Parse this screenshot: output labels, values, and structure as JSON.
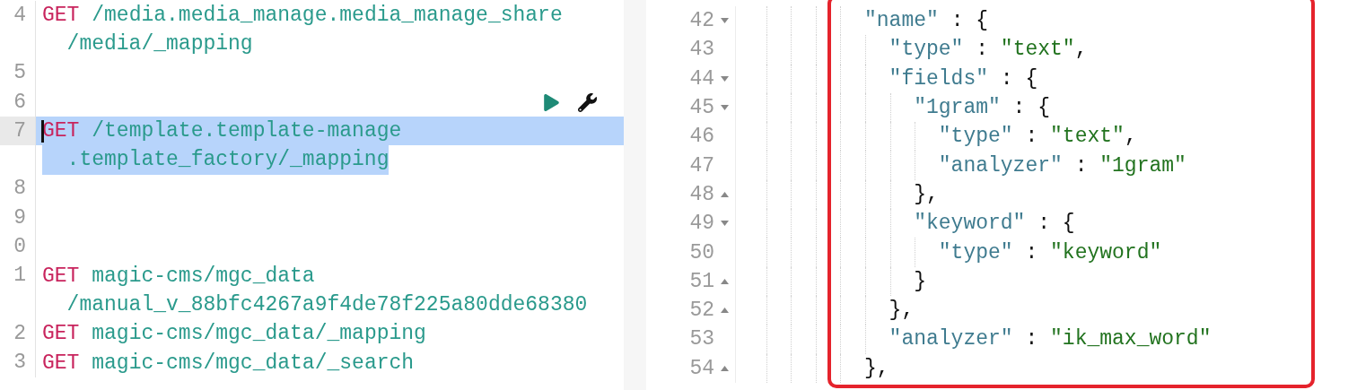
{
  "request_editor": {
    "rows": [
      {
        "number": "4",
        "method": "GET",
        "path": "/media.media_manage.media_manage_share",
        "selected": false,
        "cursor": false,
        "actions": false
      },
      {
        "continuation": "/media/_mapping",
        "selected": false
      },
      {
        "number": "5",
        "selected": false,
        "cursor": false,
        "actions": false
      },
      {
        "number": "6",
        "selected": false,
        "cursor": false,
        "actions": true
      },
      {
        "number": "7",
        "method": "GET",
        "path": "/template.template-manage",
        "selected": true,
        "cursor": true,
        "actions": false
      },
      {
        "continuation": ".template_factory/_mapping",
        "selected": true
      },
      {
        "number": "8",
        "selected": false,
        "cursor": false,
        "actions": false
      },
      {
        "number": "9",
        "selected": false,
        "cursor": false,
        "actions": false
      },
      {
        "number": "0",
        "selected": false,
        "cursor": false,
        "actions": false
      },
      {
        "number": "1",
        "method": "GET",
        "path": "magic-cms/mgc_data",
        "selected": false,
        "cursor": false,
        "actions": false
      },
      {
        "continuation": "/manual_v_88bfc4267a9f4de78f225a80dde68380",
        "selected": false
      },
      {
        "number": "2",
        "method": "GET",
        "path": "magic-cms/mgc_data/_mapping",
        "selected": false,
        "cursor": false,
        "actions": false
      },
      {
        "number": "3",
        "method": "GET",
        "path": "magic-cms/mgc_data/_search",
        "selected": false,
        "cursor": false,
        "actions": false
      }
    ]
  },
  "response_viewer": {
    "framed": true,
    "lines": [
      {
        "number": "42",
        "expanded": true,
        "tokens": [
          {
            "kind": "key",
            "text": "\"name\""
          },
          {
            "kind": "punct",
            "text": " : {"
          }
        ],
        "children": [
          {
            "number": "43",
            "tokens": [
              {
                "kind": "key",
                "text": "\"type\""
              },
              {
                "kind": "punct",
                "text": " : "
              },
              {
                "kind": "string",
                "text": "\"text\""
              },
              {
                "kind": "punct",
                "text": ","
              }
            ]
          },
          {
            "number": "44",
            "expanded": true,
            "tokens": [
              {
                "kind": "key",
                "text": "\"fields\""
              },
              {
                "kind": "punct",
                "text": " : {"
              }
            ],
            "children": [
              {
                "number": "45",
                "expanded": true,
                "tokens": [
                  {
                    "kind": "key",
                    "text": "\"1gram\""
                  },
                  {
                    "kind": "punct",
                    "text": " : {"
                  }
                ],
                "children": [
                  {
                    "number": "46",
                    "tokens": [
                      {
                        "kind": "key",
                        "text": "\"type\""
                      },
                      {
                        "kind": "punct",
                        "text": " : "
                      },
                      {
                        "kind": "string",
                        "text": "\"text\""
                      },
                      {
                        "kind": "punct",
                        "text": ","
                      }
                    ]
                  },
                  {
                    "number": "47",
                    "tokens": [
                      {
                        "kind": "key",
                        "text": "\"analyzer\""
                      },
                      {
                        "kind": "punct",
                        "text": " : "
                      },
                      {
                        "kind": "string",
                        "text": "\"1gram\""
                      }
                    ]
                  }
                ],
                "end": {
                  "number": "48",
                  "tokens": [
                    {
                      "kind": "punct",
                      "text": "},"
                    }
                  ]
                }
              },
              {
                "number": "49",
                "expanded": true,
                "tokens": [
                  {
                    "kind": "key",
                    "text": "\"keyword\""
                  },
                  {
                    "kind": "punct",
                    "text": " : {"
                  }
                ],
                "children": [
                  {
                    "number": "50",
                    "tokens": [
                      {
                        "kind": "key",
                        "text": "\"type\""
                      },
                      {
                        "kind": "punct",
                        "text": " : "
                      },
                      {
                        "kind": "string",
                        "text": "\"keyword\""
                      }
                    ]
                  }
                ],
                "end": {
                  "number": "51",
                  "tokens": [
                    {
                      "kind": "punct",
                      "text": "}"
                    }
                  ]
                }
              }
            ],
            "end": {
              "number": "52",
              "tokens": [
                {
                  "kind": "punct",
                  "text": "},"
                }
              ]
            }
          },
          {
            "number": "53",
            "tokens": [
              {
                "kind": "key",
                "text": "\"analyzer\""
              },
              {
                "kind": "punct",
                "text": " : "
              },
              {
                "kind": "string",
                "text": "\"ik_max_word\""
              }
            ]
          }
        ],
        "end": {
          "number": "54",
          "tokens": [
            {
              "kind": "punct",
              "text": "},"
            }
          ]
        }
      }
    ]
  }
}
